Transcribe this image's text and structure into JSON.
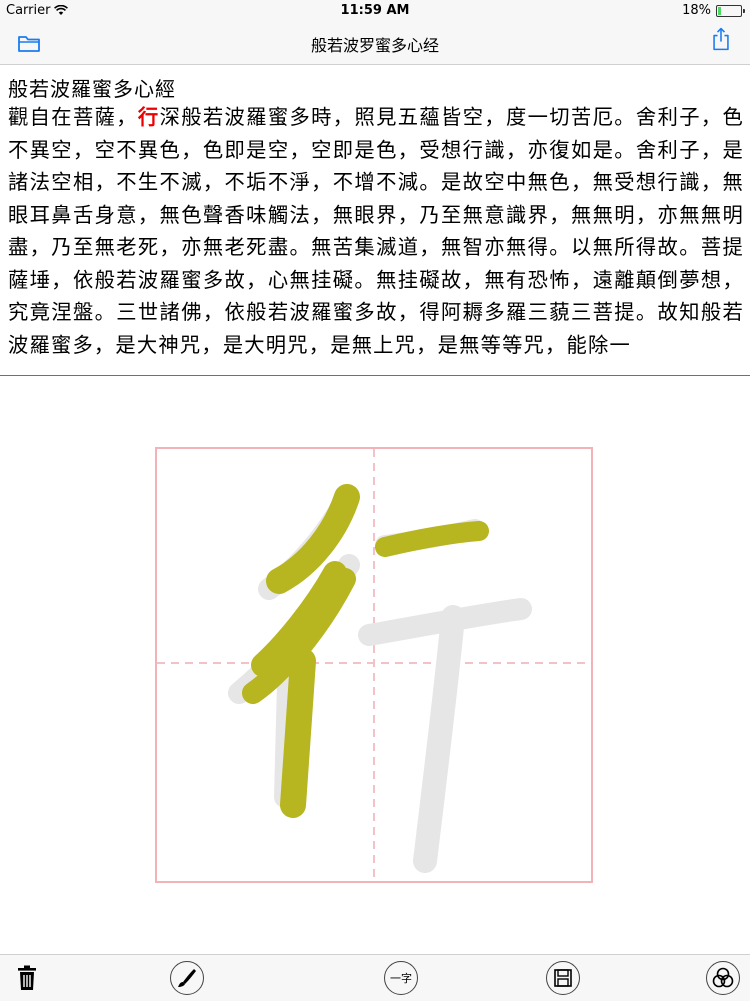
{
  "status_bar": {
    "carrier": "Carrier",
    "time": "11:59 AM",
    "battery": "18%"
  },
  "nav": {
    "title": "般若波罗蜜多心经",
    "left_icon": "folder-icon",
    "right_icon": "share-icon"
  },
  "sutra": {
    "title": "般若波羅蜜多心經",
    "highlight_char": "行",
    "text_before": "觀自在菩薩，",
    "text_after": "深般若波羅蜜多時，照見五蘊皆空，度一切苦厄。舍利子，色不異空，空不異色，色即是空，空即是色，受想行識，亦復如是。舍利子，是諸法空相，不生不滅，不垢不淨，不增不減。是故空中無色，無受想行識，無眼耳鼻舌身意，無色聲香味觸法，無眼界，乃至無意識界，無無明，亦無無明盡，乃至無老死，亦無老死盡。無苦集滅道，無智亦無得。以無所得故。菩提薩埵，依般若波羅蜜多故，心無挂礙。無挂礙故，無有恐怖，遠離顛倒夢想，究竟涅盤。三世諸佛，依般若波羅蜜多故，得阿耨多羅三藐三菩提。故知般若波羅蜜多，是大神咒，是大明咒，是無上咒，是無等等咒，能除一"
  },
  "practice": {
    "character": "行",
    "ink_color": "#b7b520",
    "guide_color": "#e6e6e6",
    "grid_border_color": "#f1b2b8"
  },
  "toolbar": {
    "items": [
      {
        "name": "trash-icon"
      },
      {
        "name": "brush-icon"
      },
      {
        "name": "character-select",
        "label": "一字"
      },
      {
        "name": "save-icon"
      },
      {
        "name": "color-palette-icon"
      }
    ]
  }
}
